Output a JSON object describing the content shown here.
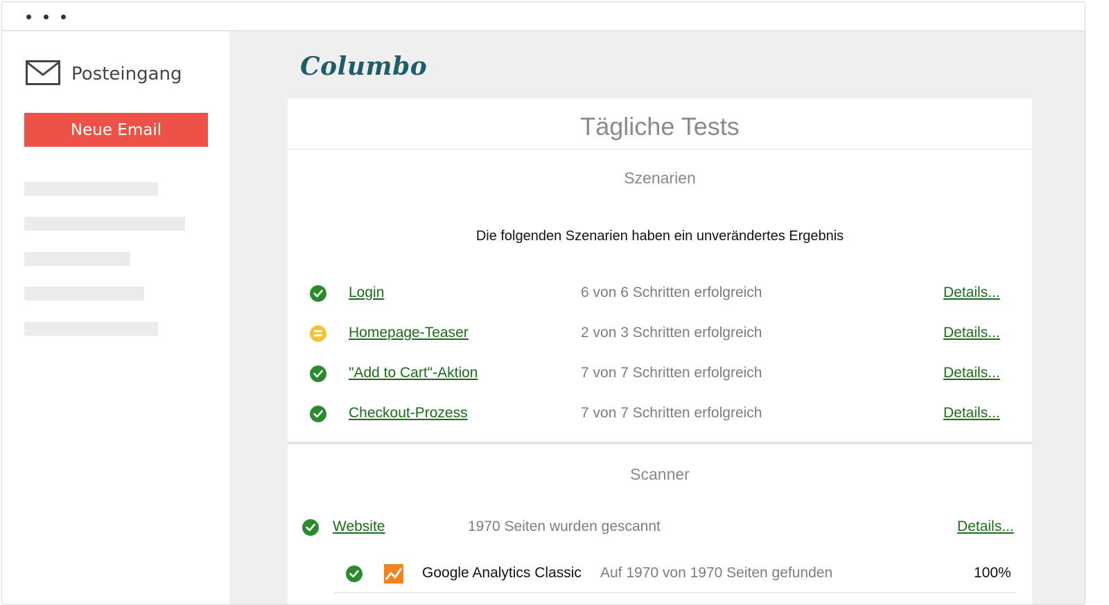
{
  "sidebar": {
    "inbox_label": "Posteingang",
    "new_email_label": "Neue Email"
  },
  "brand": {
    "logo_text": "Columbo",
    "color": "#1e5e6b"
  },
  "panel": {
    "title": "Tägliche Tests",
    "scenarios": {
      "heading": "Szenarien",
      "description": "Die folgenden Szenarien haben ein unverändertes Ergebnis",
      "rows": [
        {
          "status": "check-icon",
          "name": "Login",
          "result": "6 von 6 Schritten erfolgreich",
          "details": "Details..."
        },
        {
          "status": "warning-icon",
          "name": "Homepage-Teaser",
          "result": "2 von 3 Schritten erfolgreich",
          "details": "Details..."
        },
        {
          "status": "check-icon",
          "name": "\"Add to Cart\"-Aktion",
          "result": "7 von 7 Schritten erfolgreich",
          "details": "Details..."
        },
        {
          "status": "check-icon",
          "name": "Checkout-Prozess",
          "result": "7 von 7 Schritten erfolgreich",
          "details": "Details..."
        }
      ]
    },
    "scanner": {
      "heading": "Scanner",
      "website": {
        "name": "Website",
        "result": "1970 Seiten wurden gescannt",
        "details": "Details..."
      },
      "items": [
        {
          "name": "Google Analytics Classic",
          "result": "Auf 1970 von 1970 Seiten gefunden",
          "percent": "100%"
        }
      ]
    }
  },
  "colors": {
    "button": "#ec5246",
    "ok": "#2a8b2e",
    "warn": "#f4c430",
    "link": "#1a6b1a"
  }
}
